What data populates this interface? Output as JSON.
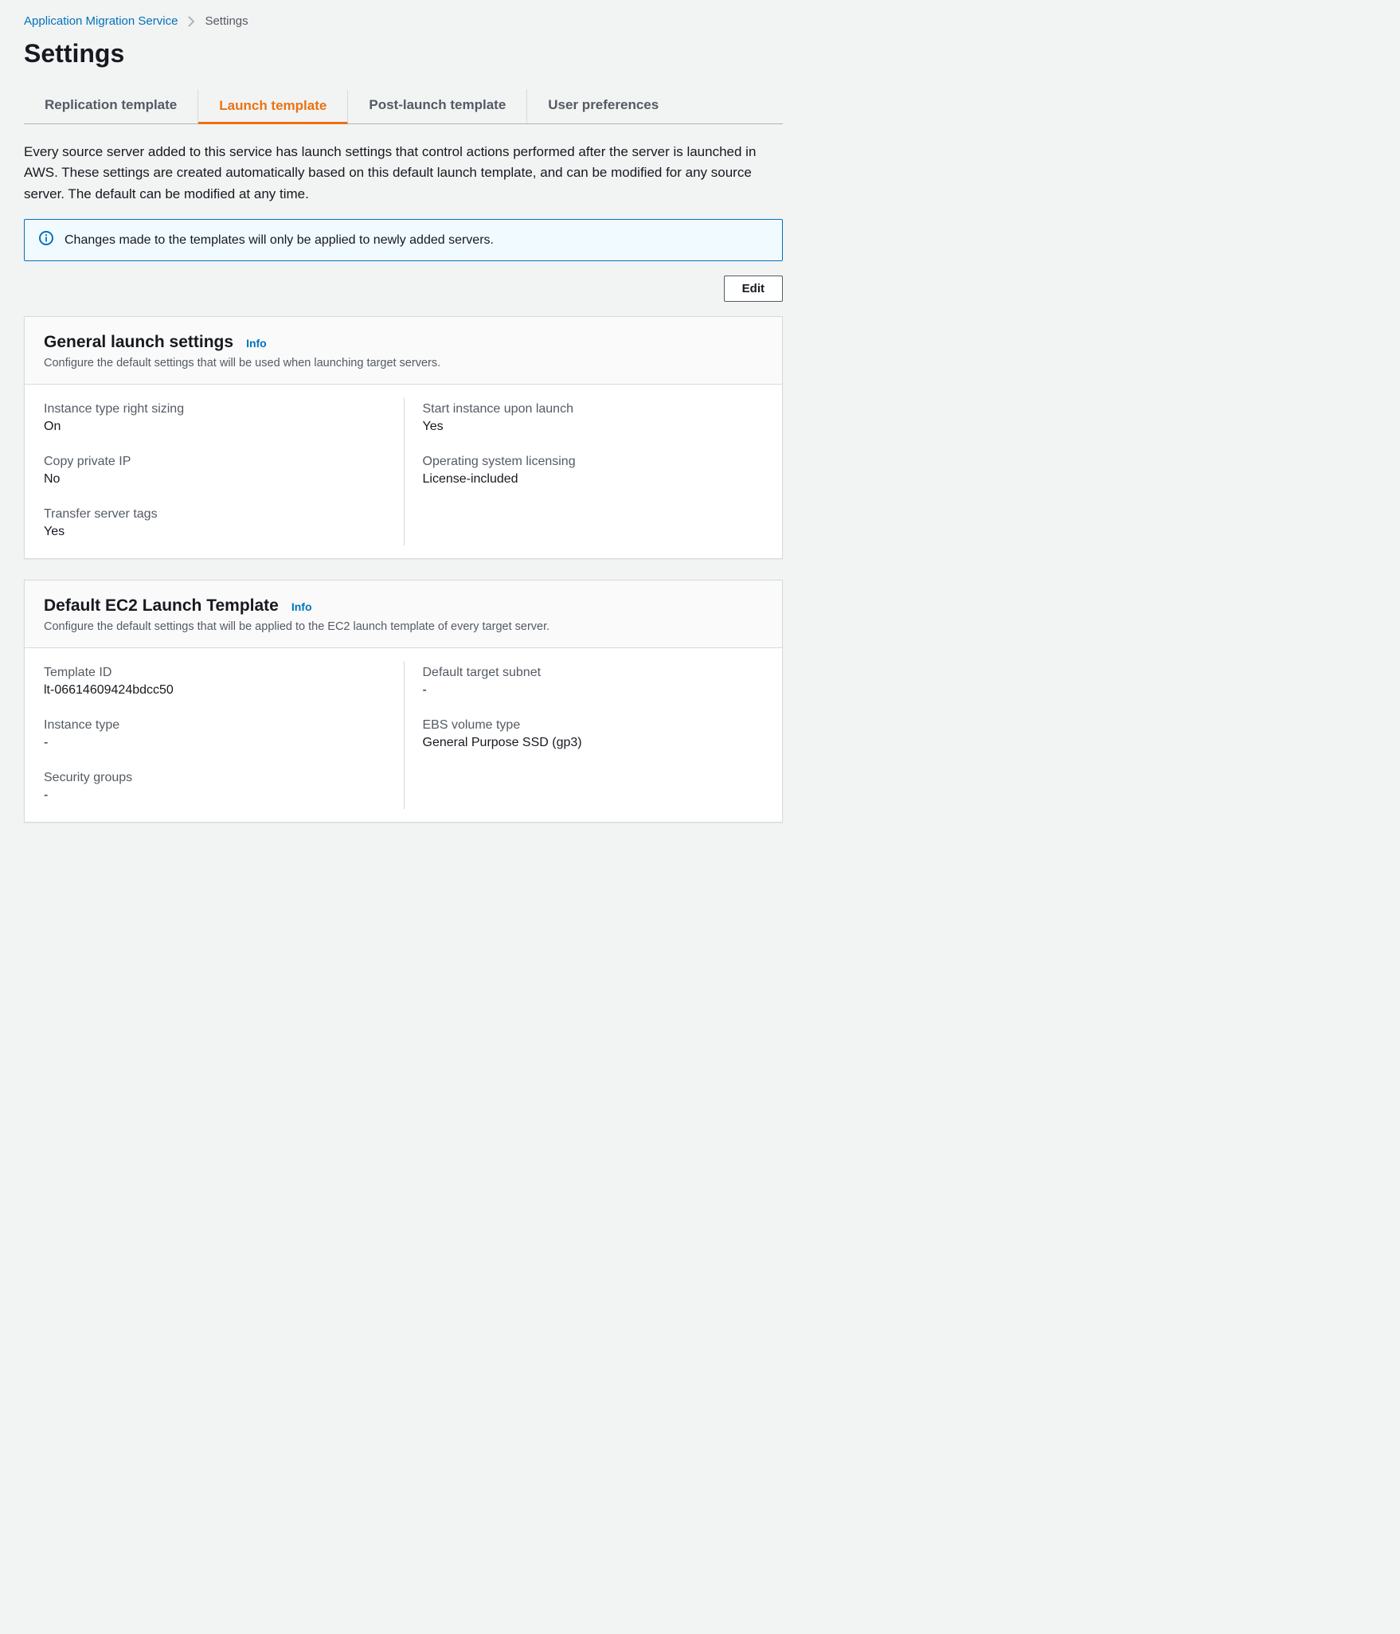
{
  "breadcrumb": {
    "root": "Application Migration Service",
    "current": "Settings"
  },
  "page_title": "Settings",
  "tabs": [
    {
      "label": "Replication template"
    },
    {
      "label": "Launch template"
    },
    {
      "label": "Post-launch template"
    },
    {
      "label": "User preferences"
    }
  ],
  "description": "Every source server added to this service has launch settings that control actions performed after the server is launched in AWS. These settings are created automatically based on this default launch template, and can be modified for any source server. The default can be modified at any time.",
  "alert": {
    "message": "Changes made to the templates will only be applied to newly added servers."
  },
  "buttons": {
    "edit": "Edit",
    "info": "Info"
  },
  "general": {
    "title": "General launch settings",
    "subtitle": "Configure the default settings that will be used when launching target servers.",
    "left": [
      {
        "label": "Instance type right sizing",
        "value": "On"
      },
      {
        "label": "Copy private IP",
        "value": "No"
      },
      {
        "label": "Transfer server tags",
        "value": "Yes"
      }
    ],
    "right": [
      {
        "label": "Start instance upon launch",
        "value": "Yes"
      },
      {
        "label": "Operating system licensing",
        "value": "License-included"
      }
    ]
  },
  "ec2": {
    "title": "Default EC2 Launch Template",
    "subtitle": "Configure the default settings that will be applied to the EC2 launch template of every target server.",
    "left": [
      {
        "label": "Template ID",
        "value": "lt-06614609424bdcc50"
      },
      {
        "label": "Instance type",
        "value": "-"
      },
      {
        "label": "Security groups",
        "value": "-"
      }
    ],
    "right": [
      {
        "label": "Default target subnet",
        "value": "-"
      },
      {
        "label": "EBS volume type",
        "value": "General Purpose SSD (gp3)"
      }
    ]
  }
}
